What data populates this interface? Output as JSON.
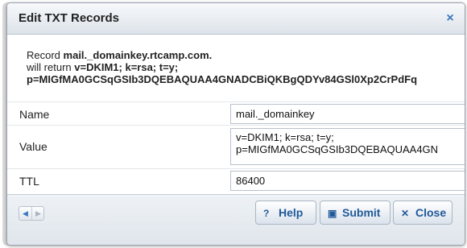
{
  "dialog": {
    "title": "Edit TXT Records",
    "close_glyph": "×"
  },
  "record": {
    "prefix": "Record ",
    "name": "mail._domainkey.rtcamp.com.",
    "will_return": "will return ",
    "value_line1": "v=DKIM1; k=rsa; t=y;",
    "value_line2": "p=MIGfMA0GCSqGSIb3DQEBAQUAA4GNADCBiQKBgQDYv84GSl0Xp2CrPdFq"
  },
  "form": {
    "name_label": "Name",
    "name_value": "mail._domainkey",
    "value_label": "Value",
    "value_line1": "v=DKIM1; k=rsa; t=y;",
    "value_line2": "p=MIGfMA0GCSqGSIb3DQEBAQUAA4GN",
    "ttl_label": "TTL",
    "ttl_value": "86400"
  },
  "footer": {
    "help_label": "Help",
    "submit_label": "Submit",
    "close_label": "Close",
    "help_icon": "question-icon",
    "submit_icon": "disk-icon",
    "close_icon": "close-icon"
  }
}
